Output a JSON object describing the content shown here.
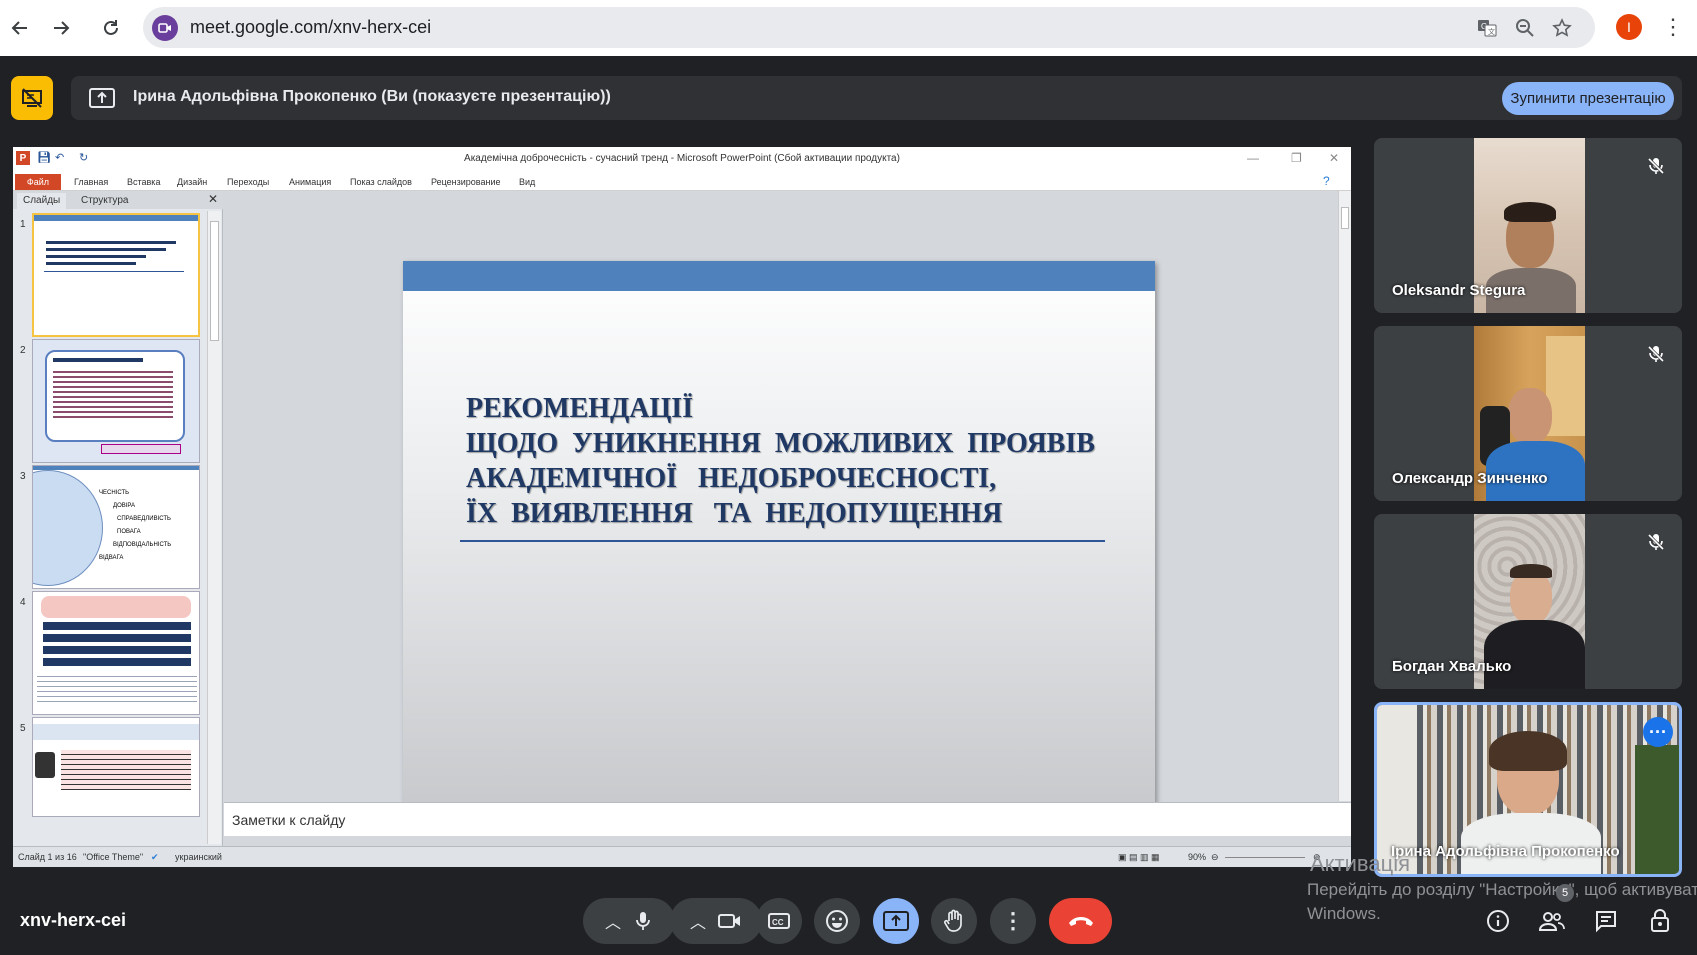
{
  "browser": {
    "url": "meet.google.com/xnv-herx-cei",
    "profile_initial": "I"
  },
  "banner": {
    "presenter_label": "Ірина Адольфівна Прокопенко (Ви (показуєте презентацію))",
    "stop_button_label": "Зупинити презентацію"
  },
  "powerpoint": {
    "window_title": "Академічна доброчесність - сучасний тренд - Microsoft PowerPoint (Сбой активации продукта)",
    "tabs": [
      "Файл",
      "Главная",
      "Вставка",
      "Дизайн",
      "Переходы",
      "Анимация",
      "Показ слайдов",
      "Рецензирование",
      "Вид"
    ],
    "pane_tabs": [
      "Слайды",
      "Структура"
    ],
    "thumbnail_numbers": [
      "1",
      "2",
      "3",
      "4",
      "5"
    ],
    "slide_title_lines": [
      "РЕКОМЕНДАЦІЇ",
      "ЩОДО  УНИКНЕННЯ  МОЖЛИВИХ  ПРОЯВІВ",
      "АКАДЕМІЧНОЇ   НЕДОБРОЧЕСНОСТІ,",
      "ЇХ  ВИЯВЛЕННЯ   ТА  НЕДОПУЩЕННЯ"
    ],
    "notes_placeholder": "Заметки к слайду",
    "status": {
      "slide_counter": "Слайд 1 из 16",
      "theme": "\"Office Theme\"",
      "language": "украинский",
      "zoom": "90%"
    },
    "thumb3_labels": [
      "ЧЕСНІСТЬ",
      "ДОВІРА",
      "СПРАВЕДЛИВІСТЬ",
      "ПОВАГА",
      "ВІДПОВІДАЛЬНІСТЬ",
      "ВІДВАГА"
    ]
  },
  "participants": [
    {
      "name": "Oleksandr Stegura",
      "muted": true
    },
    {
      "name": "Олександр Зинченко",
      "muted": true
    },
    {
      "name": "Богдан Хвалько",
      "muted": true
    },
    {
      "name": "Ірина Адольфівна Прокопенко",
      "muted": false,
      "self": true
    }
  ],
  "bottom_bar": {
    "meeting_code": "xnv-herx-cei",
    "people_count": "5"
  },
  "windows_watermark": {
    "line1": "Активація",
    "line2": "Перейдіть до розділу \"Настройки\", щоб активувати",
    "line3": "Windows."
  },
  "colors": {
    "meet_bg": "#202124",
    "tile_bg": "#3c4043",
    "accent_blue": "#8ab4f8",
    "end_call_red": "#ea4335",
    "banner_yellow": "#fbbc04",
    "slide_blue_bar": "#4f81bd",
    "slide_title": "#1f3864"
  }
}
